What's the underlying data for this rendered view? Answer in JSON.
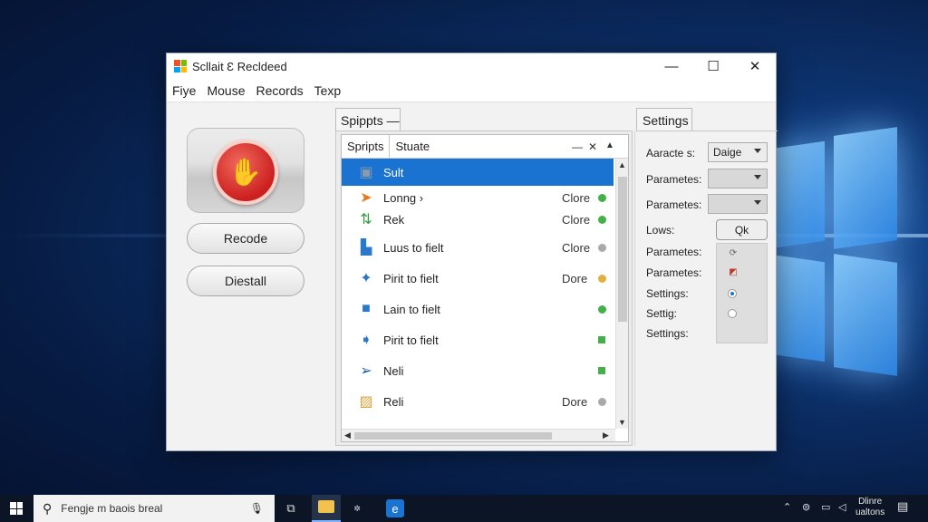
{
  "window": {
    "title": "Scllait Ɛ Recldeed",
    "controls": {
      "minimize": "—",
      "maximize": "☐",
      "close": "✕"
    }
  },
  "menu": [
    "Fiye",
    "Mouse",
    "Records",
    "Texp"
  ],
  "left_panel": {
    "record_icon": "record-hand-icon",
    "buttons": [
      "Recode",
      "Diestall"
    ]
  },
  "middle_panel": {
    "outer_tab": "Spippts —",
    "inner_tabs": [
      "Spripts",
      "Stuate"
    ],
    "inner_controls": {
      "minimize": "—",
      "close": "✕",
      "scroll_up": "▲"
    },
    "rows": [
      {
        "label": "Sult",
        "status": "",
        "indicator": "",
        "icon": "cube-icon",
        "selected": true
      },
      {
        "label": "Lonng ›",
        "status": "Clore",
        "indicator": "#44b04a",
        "icon": "orange-arrow-icon",
        "selected": false
      },
      {
        "label": "Rek",
        "status": "Clore",
        "indicator": "#44b04a",
        "icon": "green-arrows-icon",
        "selected": false
      },
      {
        "label": "Luus to fielt",
        "status": "Clore",
        "indicator": "#a9a9a9",
        "icon": "blue-puzzle-icon",
        "selected": false
      },
      {
        "label": "Pirit to fielt",
        "status": "Dore",
        "indicator": "#e0b040",
        "icon": "blue-star-icon",
        "selected": false
      },
      {
        "label": "Lain to fielt",
        "status": "",
        "indicator": "#44b04a",
        "icon": "blue-square-icon",
        "selected": false
      },
      {
        "label": "Pirit to fielt",
        "status": "",
        "indicator": "#44b04a",
        "icon": "blue-plane-icon",
        "selected": false
      },
      {
        "label": "Neli",
        "status": "",
        "indicator": "#44b04a",
        "icon": "blue-arrow-icon",
        "selected": false
      },
      {
        "label": "Reli",
        "status": "Dore",
        "indicator": "#a9a9a9",
        "icon": "yellow-box-icon",
        "selected": false
      }
    ]
  },
  "settings": {
    "tab": "Settings",
    "labels": [
      "Aaracte s:",
      "Parametes:",
      "Parametes:",
      "Lows:",
      "Parametes:",
      "Parametes:",
      "Settings:",
      "Settig:",
      "Settings:"
    ],
    "dropdowns": [
      "Daige",
      "",
      ""
    ],
    "ok_button": "Qk"
  },
  "taskbar": {
    "search_placeholder": "Fengje m baois breal",
    "clock_line1": "Dlinre",
    "clock_line2": "ualtons"
  },
  "colors": {
    "accent": "#1a73d0",
    "record": "#d62a26"
  }
}
